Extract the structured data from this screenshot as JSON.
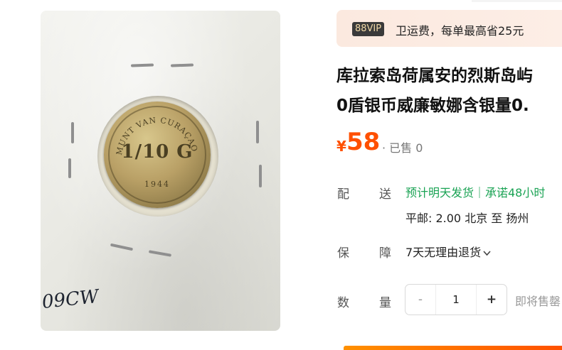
{
  "photo": {
    "alt": "coin photo",
    "coin_legend": "MUNT VAN CURAÇAO",
    "coin_denomination": "1/10 G",
    "coin_year": "1944",
    "handwriting": "09CW"
  },
  "vip": {
    "badge": "88VIP",
    "text": "卫运费，每单最高省25元"
  },
  "product": {
    "title_line1": "库拉索岛荷属安的烈斯岛屿",
    "title_line2": "0盾银币威廉敏娜含银量0."
  },
  "price": {
    "symbol": "¥",
    "value": "58",
    "sold": "· 已售 0"
  },
  "delivery": {
    "label_a": "配",
    "label_b": "送",
    "estimate": "预计明天发货｜承诺48小时",
    "shipping": "平邮: 2.00  北京  至  扬州"
  },
  "guarantee": {
    "label_a": "保",
    "label_b": "障",
    "text": "7天无理由退货"
  },
  "quantity": {
    "label_a": "数",
    "label_b": "量",
    "minus": "-",
    "value": "1",
    "plus": "+",
    "note": "即将售罄"
  },
  "colors": {
    "price": "#ff5000",
    "delivery": "#1aa354"
  }
}
